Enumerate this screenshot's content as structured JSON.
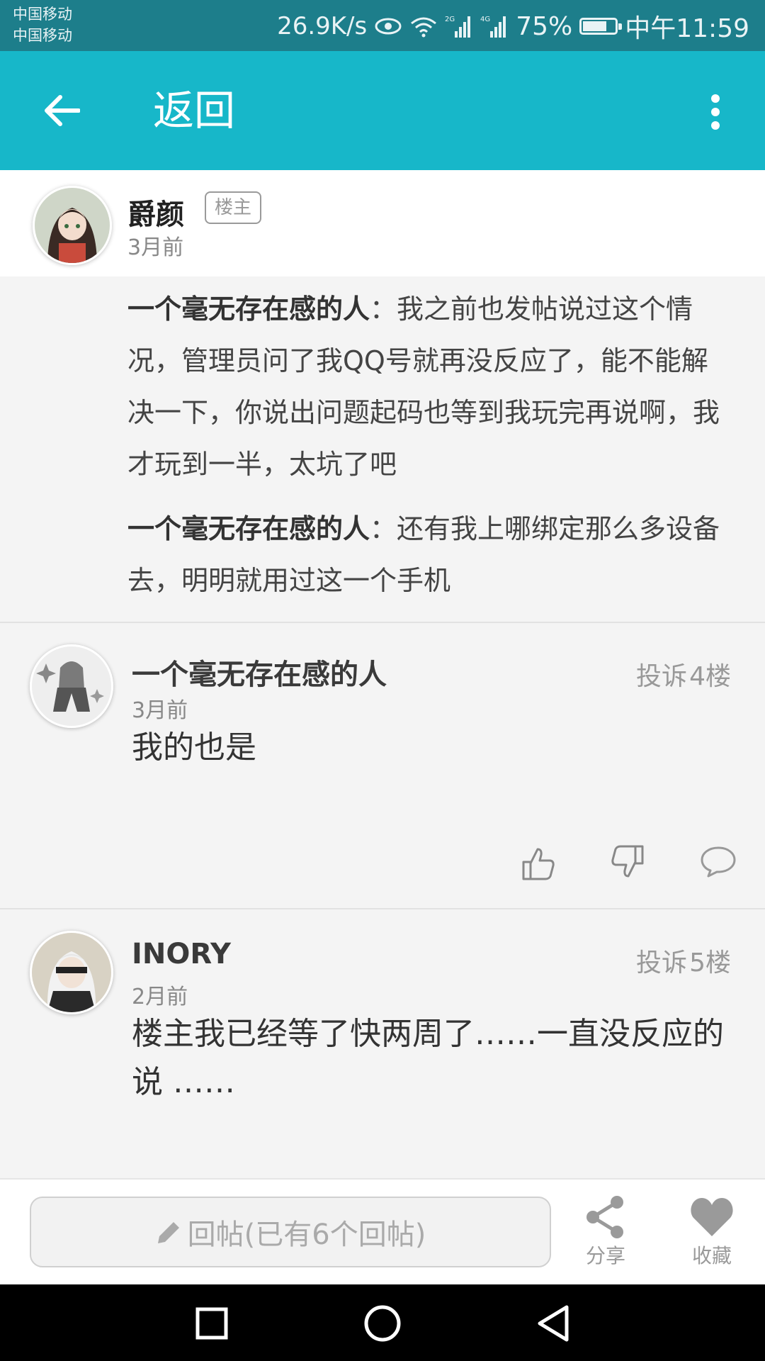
{
  "status_bar": {
    "carrier1": "中国移动",
    "carrier2": "中国移动",
    "speed": "26.9K/s",
    "signal1_label": "2G",
    "signal2_label": "4G",
    "battery_percent": "75%",
    "battery_level": 0.75,
    "time": "中午11:59"
  },
  "toolbar": {
    "title": "返回"
  },
  "op": {
    "name": "爵颜",
    "badge": "楼主",
    "time": "3月前",
    "quotes": [
      {
        "author": "一个毫无存在感的人",
        "text": "：我之前也发帖说过这个情况，管理员问了我QQ号就再没反应了，能不能解决一下，你说出问题起码也等到我玩完再说啊，我才玩到一半，太坑了吧"
      },
      {
        "author": "一个毫无存在感的人",
        "text": "：还有我上哪绑定那么多设备去，明明就用过这一个手机"
      }
    ]
  },
  "floors": [
    {
      "name": "一个毫无存在感的人",
      "time": "3月前",
      "report": "投诉",
      "floor": "4楼",
      "content": "我的也是"
    },
    {
      "name": "INORY",
      "time": "2月前",
      "report": "投诉",
      "floor": "5楼",
      "content": "楼主我已经等了快两周了……一直没反应的说 ……"
    }
  ],
  "bottom_bar": {
    "reply_placeholder": "回帖(已有6个回帖)",
    "share_label": "分享",
    "favorite_label": "收藏"
  },
  "colors": {
    "toolbar": "#17b7c9",
    "status_bar": "#1d7e8b"
  }
}
